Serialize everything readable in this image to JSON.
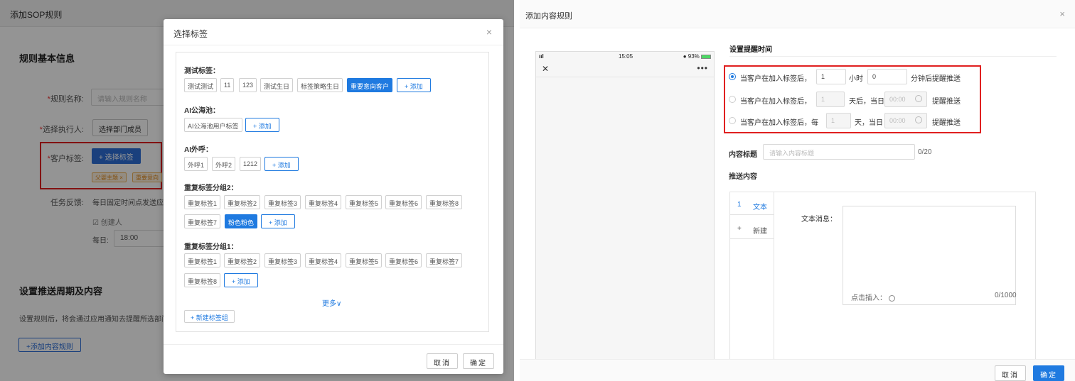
{
  "left": {
    "window_title": "添加SOP规则",
    "section_basic": "规则基本信息",
    "rule_name": {
      "label_req": "*",
      "label": "规则名称:",
      "placeholder": "请输入规则名称"
    },
    "executor": {
      "label_req": "*",
      "label": "选择执行人:",
      "button": "选择部门成员"
    },
    "customer_tag": {
      "label_req": "*",
      "label": "客户标签:",
      "button": "+ 选择标签",
      "chips": [
        "父婴主题 ×",
        "重要意向"
      ]
    },
    "feedback": {
      "label": "任务反馈:",
      "text": "每日固定时间点发送应用",
      "checkbox": "创建人",
      "daily_label": "每日:",
      "daily_time": "18:00"
    },
    "section_push": "设置推送周期及内容",
    "push_desc": "设置规则后，将会通过应用通知去提醒所选部门",
    "add_rule_button": "+添加内容规则"
  },
  "modal": {
    "title": "选择标签",
    "close": "×",
    "groups": [
      {
        "title": "测试标签：",
        "tags": [
          "测试测试",
          "11",
          "123",
          "测试生日",
          "标签策略生日",
          "重要意向客户"
        ],
        "selected": "重要意向客户",
        "add": "+ 添加"
      },
      {
        "title": "AI公海池：",
        "tags": [
          "AI公海池用户标签"
        ],
        "add": "+ 添加"
      },
      {
        "title": "AI外呼：",
        "tags": [
          "外呼1",
          "外呼2",
          "1212"
        ],
        "add": "+ 添加"
      },
      {
        "title": "重复标签分组2：",
        "tags": [
          "重复标签1",
          "重复标签2",
          "重复标签3",
          "重复标签4",
          "重复标签5",
          "重复标签6",
          "重复标签8",
          "重复标签7",
          "粉色粉色"
        ],
        "selected": "粉色粉色",
        "add": "+ 添加"
      },
      {
        "title": "重复标签分组1：",
        "tags": [
          "重复标签1",
          "重复标签2",
          "重复标签3",
          "重复标签4",
          "重复标签5",
          "重复标签6",
          "重复标签7",
          "重复标签8"
        ],
        "add": "+ 添加"
      }
    ],
    "more": "更多∨",
    "new_group": "+ 新建标签组",
    "cancel": "取消",
    "confirm": "确定"
  },
  "right": {
    "title": "添加内容规则",
    "close": "×",
    "phone": {
      "signal": "ııl",
      "time": "15:05",
      "battery": "● 93%",
      "close": "✕",
      "more": "•••"
    },
    "remind_section": "设置提醒时间",
    "options": [
      {
        "checked": true,
        "prefix": "当客户在加入标签后，",
        "value1": "1",
        "unit1": "小时",
        "value2": "0",
        "suffix": "分钟后提醒推送"
      },
      {
        "checked": false,
        "prefix": "当客户在加入标签后，",
        "value1": "1",
        "unit1": "天后，当日",
        "time": "00:00",
        "suffix": "提醒推送"
      },
      {
        "checked": false,
        "prefix": "当客户在加入标签后，每",
        "value1": "1",
        "unit1": "天，当日",
        "time": "00:00",
        "suffix": "提醒推送"
      }
    ],
    "content_title": {
      "label": "内容标题",
      "placeholder": "请输入内容标题",
      "count": "0/20"
    },
    "push_content": "推送内容",
    "editor": {
      "items": [
        {
          "num": "1",
          "text": "文本"
        },
        {
          "num": "+",
          "text": "新建"
        }
      ],
      "text_label": "文本消息：",
      "insert": "点击插入：",
      "count": "0/1000"
    },
    "cancel": "取消",
    "confirm": "确定"
  }
}
